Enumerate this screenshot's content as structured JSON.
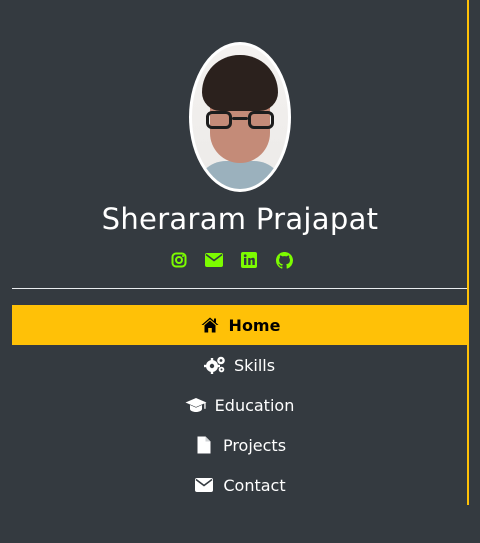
{
  "profile": {
    "name": "Sheraram Prajapat",
    "avatar_alt": "profile photo"
  },
  "socials": [
    {
      "icon": "instagram-icon"
    },
    {
      "icon": "envelope-icon"
    },
    {
      "icon": "linkedin-icon"
    },
    {
      "icon": "github-icon"
    }
  ],
  "nav": {
    "items": [
      {
        "label": "Home",
        "icon": "home-icon",
        "active": true
      },
      {
        "label": "Skills",
        "icon": "gears-icon",
        "active": false
      },
      {
        "label": "Education",
        "icon": "graduation-cap-icon",
        "active": false
      },
      {
        "label": "Projects",
        "icon": "file-icon",
        "active": false
      },
      {
        "label": "Contact",
        "icon": "envelope-icon",
        "active": false
      }
    ]
  },
  "colors": {
    "background": "#343a40",
    "accent": "#ffc107",
    "social": "#7cfc00",
    "text": "#ffffff"
  }
}
